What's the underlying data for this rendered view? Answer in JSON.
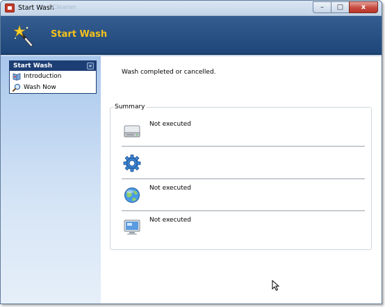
{
  "window": {
    "title": "Start Wash",
    "title_ghost": "- Cleaner",
    "minimize_glyph": "–",
    "maximize_glyph": "□",
    "close_glyph": "x"
  },
  "banner": {
    "title": "Start Wash",
    "icon": "magic-wand-icon",
    "title_color": "#f5c21b"
  },
  "sidebar": {
    "group_title": "Start Wash",
    "collapse_glyph": "«",
    "items": [
      {
        "label": "Introduction",
        "icon": "book-icon"
      },
      {
        "label": "Wash Now",
        "icon": "magnifier-icon"
      }
    ]
  },
  "main": {
    "status_text": "Wash completed or cancelled.",
    "summary_label": "Summary",
    "rows": [
      {
        "icon": "hard-drive-icon",
        "text": "Not executed"
      },
      {
        "icon": "gear-icon",
        "text": ""
      },
      {
        "icon": "globe-icon",
        "text": "Not executed"
      },
      {
        "icon": "monitor-icon",
        "text": "Not executed"
      }
    ]
  },
  "colors": {
    "banner": "#1f4678",
    "group_header": "#1d3e74",
    "accent_yellow": "#f5c21b"
  }
}
